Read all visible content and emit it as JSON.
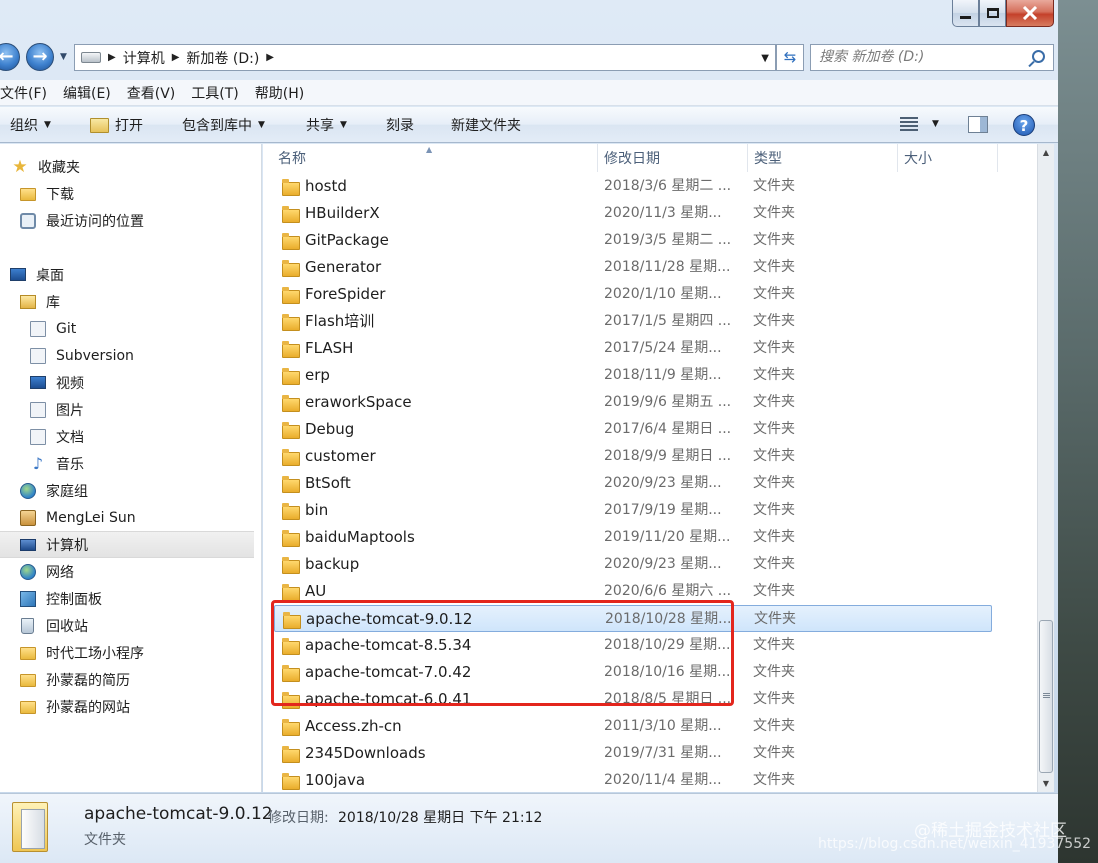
{
  "address": {
    "crumbs": [
      "计算机",
      "新加卷 (D:)"
    ],
    "search_placeholder": "搜索 新加卷 (D:)"
  },
  "menu": [
    "文件(F)",
    "编辑(E)",
    "查看(V)",
    "工具(T)",
    "帮助(H)"
  ],
  "toolbar": {
    "organize": "组织",
    "open": "打开",
    "include_library": "包含到库中",
    "share": "共享",
    "burn": "刻录",
    "new_folder": "新建文件夹"
  },
  "nav": {
    "favorites": "收藏夹",
    "downloads": "下载",
    "recent": "最近访问的位置",
    "desktop": "桌面",
    "libraries": "库",
    "git": "Git",
    "subversion": "Subversion",
    "videos": "视频",
    "pictures": "图片",
    "documents": "文档",
    "music": "音乐",
    "homegroup": "家庭组",
    "user": "MengLei Sun",
    "computer": "计算机",
    "network": "网络",
    "control_panel": "控制面板",
    "recycle_bin": "回收站",
    "fav1": "时代工场小程序",
    "fav2": "孙蒙磊的简历",
    "fav3": "孙蒙磊的网站"
  },
  "columns": {
    "name": "名称",
    "date": "修改日期",
    "type": "类型",
    "size": "大小"
  },
  "files": [
    {
      "name": "hostd",
      "date": "2018/3/6 星期二 ...",
      "type": "文件夹"
    },
    {
      "name": "HBuilderX",
      "date": "2020/11/3 星期...",
      "type": "文件夹"
    },
    {
      "name": "GitPackage",
      "date": "2019/3/5 星期二 ...",
      "type": "文件夹"
    },
    {
      "name": "Generator",
      "date": "2018/11/28 星期...",
      "type": "文件夹"
    },
    {
      "name": "ForeSpider",
      "date": "2020/1/10 星期...",
      "type": "文件夹"
    },
    {
      "name": "Flash培训",
      "date": "2017/1/5 星期四 ...",
      "type": "文件夹"
    },
    {
      "name": "FLASH",
      "date": "2017/5/24 星期...",
      "type": "文件夹"
    },
    {
      "name": "erp",
      "date": "2018/11/9 星期...",
      "type": "文件夹"
    },
    {
      "name": "eraworkSpace",
      "date": "2019/9/6 星期五 ...",
      "type": "文件夹"
    },
    {
      "name": "Debug",
      "date": "2017/6/4 星期日 ...",
      "type": "文件夹"
    },
    {
      "name": "customer",
      "date": "2018/9/9 星期日 ...",
      "type": "文件夹"
    },
    {
      "name": "BtSoft",
      "date": "2020/9/23 星期...",
      "type": "文件夹"
    },
    {
      "name": "bin",
      "date": "2017/9/19 星期...",
      "type": "文件夹"
    },
    {
      "name": "baiduMaptools",
      "date": "2019/11/20 星期...",
      "type": "文件夹"
    },
    {
      "name": "backup",
      "date": "2020/9/23 星期...",
      "type": "文件夹"
    },
    {
      "name": "AU",
      "date": "2020/6/6 星期六 ...",
      "type": "文件夹"
    },
    {
      "name": "apache-tomcat-9.0.12",
      "date": "2018/10/28 星期...",
      "type": "文件夹"
    },
    {
      "name": "apache-tomcat-8.5.34",
      "date": "2018/10/29 星期...",
      "type": "文件夹"
    },
    {
      "name": "apache-tomcat-7.0.42",
      "date": "2018/10/16 星期...",
      "type": "文件夹"
    },
    {
      "name": "apache-tomcat-6.0.41",
      "date": "2018/8/5 星期日 ...",
      "type": "文件夹"
    },
    {
      "name": "Access.zh-cn",
      "date": "2011/3/10 星期...",
      "type": "文件夹"
    },
    {
      "name": "2345Downloads",
      "date": "2019/7/31 星期...",
      "type": "文件夹"
    },
    {
      "name": "100java",
      "date": "2020/11/4 星期...",
      "type": "文件夹"
    }
  ],
  "details": {
    "name": "apache-tomcat-9.0.12",
    "modified_label": "修改日期:",
    "modified_value": "2018/10/28 星期日 下午 21:12",
    "type": "文件夹"
  },
  "watermark": {
    "line1": "@稀土掘金技术社区",
    "line2": "https://blog.csdn.net/weixin_41937552"
  },
  "colors": {
    "selection": "#cfe5fb",
    "annotation_box": "#e3261d"
  }
}
